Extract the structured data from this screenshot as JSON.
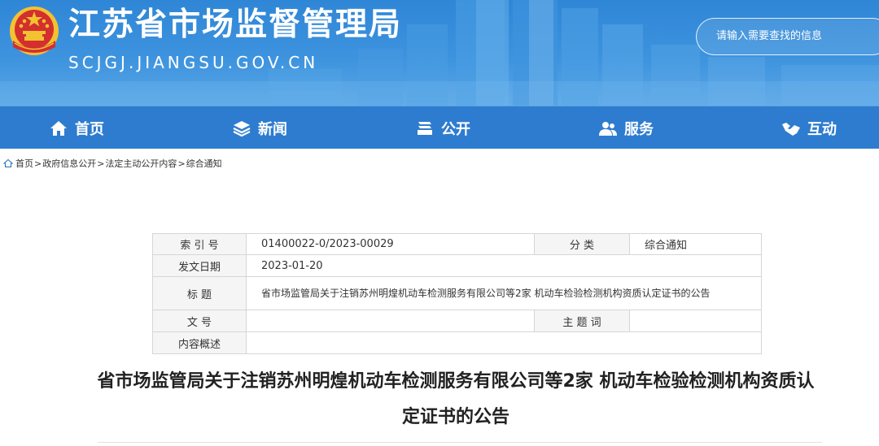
{
  "header": {
    "site_title": "江苏省市场监督管理局",
    "site_domain": "SCJGJ.JIANGSU.GOV.CN",
    "search_placeholder": "请输入需要查找的信息"
  },
  "nav": {
    "items": [
      {
        "label": "首页",
        "icon": "home-icon"
      },
      {
        "label": "新闻",
        "icon": "layers-icon"
      },
      {
        "label": "公开",
        "icon": "stack-icon"
      },
      {
        "label": "服务",
        "icon": "people-icon"
      },
      {
        "label": "互动",
        "icon": "handshake-icon"
      }
    ]
  },
  "breadcrumb": {
    "icon": "home-icon",
    "items": [
      "首页",
      "政府信息公开",
      "法定主动公开内容",
      "综合通知"
    ],
    "separator": ">"
  },
  "info_table": {
    "index_label": "索 引 号",
    "index_value": "01400022-0/2023-00029",
    "category_label": "分 类",
    "category_value": "综合通知",
    "date_label": "发文日期",
    "date_value": "2023-01-20",
    "title_label": "标 题",
    "title_value": "省市场监管局关于注销苏州明煌机动车检测服务有限公司等2家 机动车检验检测机构资质认定证书的公告",
    "doc_number_label": "文 号",
    "doc_number_value": "",
    "keywords_label": "主 题 词",
    "keywords_value": "",
    "summary_label": "内容概述",
    "summary_value": ""
  },
  "article": {
    "title": "省市场监管局关于注销苏州明煌机动车检测服务有限公司等2家 机动车检验检测机构资质认定证书的公告"
  },
  "colors": {
    "header_blue": "#2f86d6",
    "nav_blue": "#2e7ccf",
    "emblem_red": "#d32f2f",
    "emblem_gold": "#f2c230"
  }
}
